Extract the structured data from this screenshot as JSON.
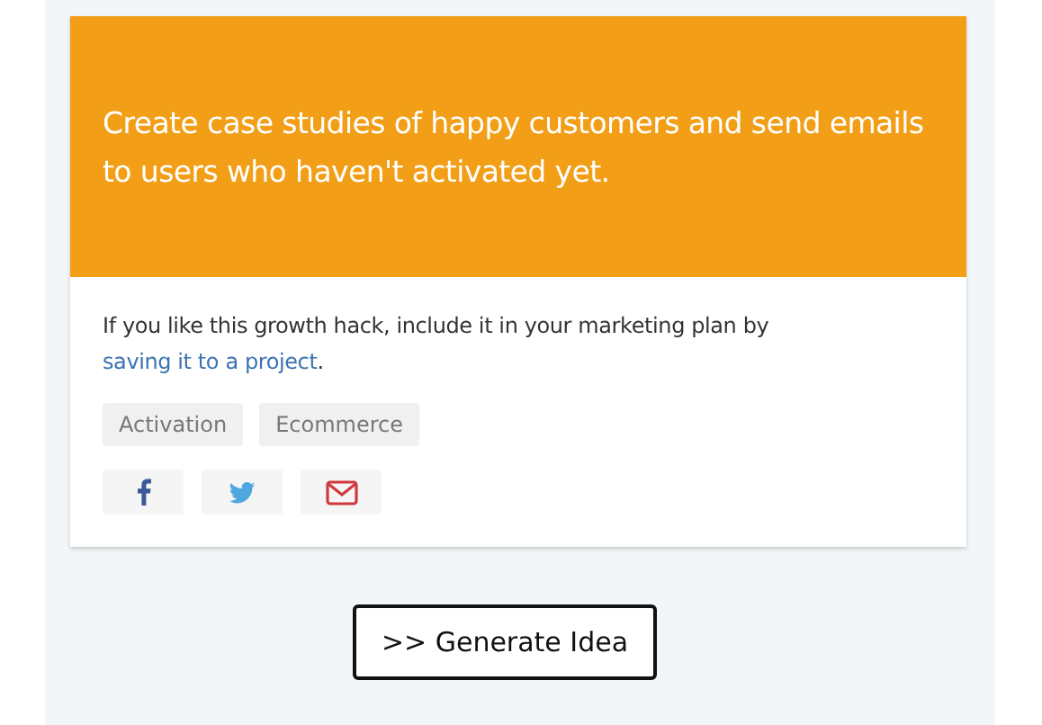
{
  "card": {
    "headline": "Create case studies of happy customers and send emails to users who haven't activated yet.",
    "note": {
      "before": "If you like this growth hack, include it in your marketing plan by ",
      "link": "saving it to a project",
      "after": "."
    },
    "tags": [
      "Activation",
      "Ecommerce"
    ],
    "share_buttons": [
      {
        "kind": "facebook"
      },
      {
        "kind": "twitter"
      },
      {
        "kind": "email"
      }
    ]
  },
  "generate_button": ">> Generate Idea"
}
